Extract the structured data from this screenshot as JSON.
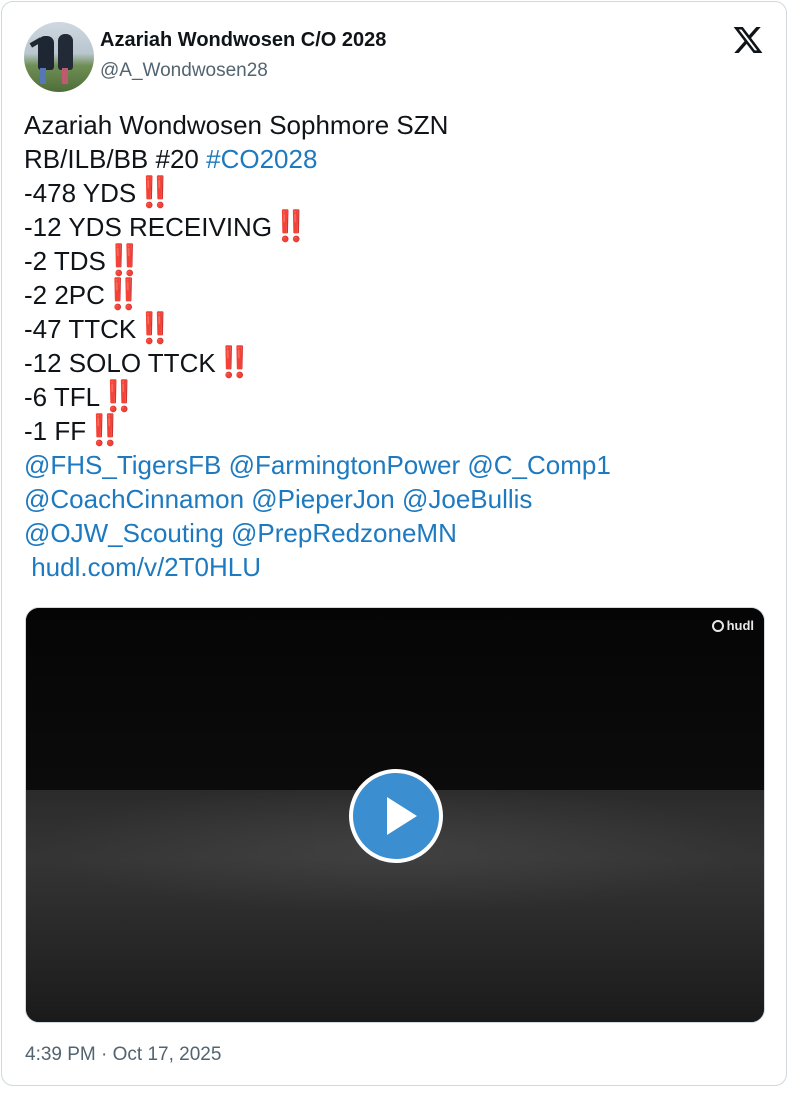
{
  "author": {
    "name": "Azariah Wondwosen C/O 2028",
    "handle": "@A_Wondwosen28"
  },
  "tweet": {
    "lines": [
      {
        "text": "Azariah Wondwosen Sophmore SZN"
      },
      {
        "text": "RB/ILB/BB #20 ",
        "link": "#CO2028"
      },
      {
        "text": "-478 YDS",
        "emoji": "‼️"
      },
      {
        "text": "-12 YDS RECEIVING",
        "emoji": "‼️"
      },
      {
        "text": "-2 TDS",
        "emoji": "‼️"
      },
      {
        "text": "-2 2PC",
        "emoji": "‼️"
      },
      {
        "text": "-47 TTCK",
        "emoji": "‼️"
      },
      {
        "text": "-12 SOLO TTCK",
        "emoji": "‼️"
      },
      {
        "text": "-6 TFL",
        "emoji": "‼️"
      },
      {
        "text": "-1 FF",
        "emoji": "‼️"
      }
    ],
    "mentions_line1": "@FHS_TigersFB @FarmingtonPower @C_Comp1",
    "mentions_line2": "@CoachCinnamon @PieperJon @JoeBullis",
    "mentions_line3": "@OJW_Scouting @PrepRedzoneMN",
    "url": " hudl.com/v/2T0HLU"
  },
  "video": {
    "watermark": "hudl",
    "play_icon": "play-icon"
  },
  "timestamp": "4:39 PM · Oct 17, 2025",
  "colors": {
    "link": "#1d7ac0",
    "text": "#0f1419",
    "secondary": "#536471",
    "play_button": "#3b8ed0",
    "emoji": "#c81e3a"
  }
}
